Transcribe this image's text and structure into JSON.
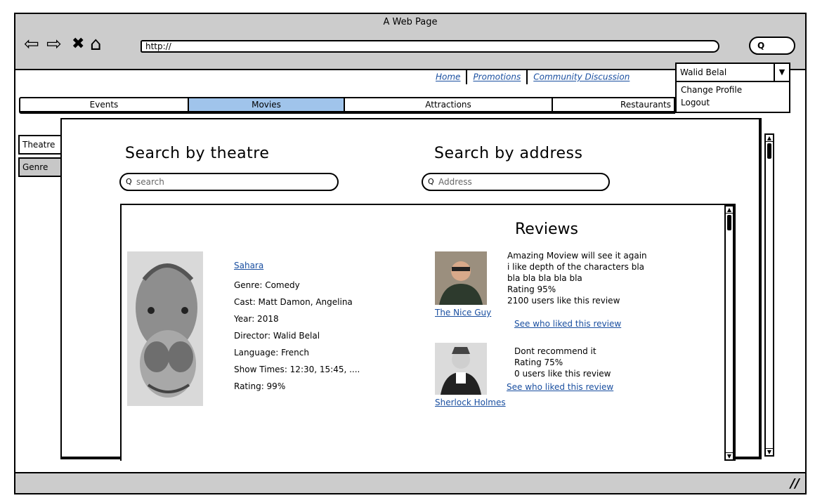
{
  "window": {
    "title": "A Web Page",
    "url": "http://",
    "go_icon": "search-icon"
  },
  "header": {
    "links": [
      "Home",
      "Promotions",
      "Community Discussion"
    ],
    "user": {
      "selected": "Walid Belal",
      "menu": [
        "Change Profile",
        "Logout"
      ]
    }
  },
  "tabs": [
    "Events",
    "Movies",
    "Attractions",
    "Restaurants"
  ],
  "selected_tab": "Movies",
  "side_tabs": [
    "Theatre",
    "Genre"
  ],
  "search_theatre": {
    "heading": "Search by theatre",
    "placeholder": "search"
  },
  "search_address": {
    "heading": "Search by address",
    "placeholder": "Address"
  },
  "movie": {
    "title": "Sahara",
    "genre": "Genre: Comedy",
    "cast": "Cast: Matt Damon, Angelina",
    "year": "Year: 2018",
    "director": "Director: Walid Belal",
    "language": "Language: French",
    "showtimes": "Show Times: 12:30, 15:45, ....",
    "rating": "Rating: 99%"
  },
  "reviews": {
    "heading": "Reviews",
    "items": [
      {
        "user": "The Nice Guy",
        "lines": [
          "Amazing Moview will see it again",
          "i like depth of the characters bla",
          "bla bla bla bla bla",
          "Rating 95%",
          "2100 users like this review"
        ],
        "link": "See who liked this review"
      },
      {
        "user": "Sherlock Holmes",
        "lines": [
          "Dont recommend it",
          "Rating 75%",
          "0 users like this review"
        ],
        "link": "See who liked this review"
      }
    ]
  },
  "colors": {
    "chrome": "#cccccc",
    "selected_tab": "#a0c4eb",
    "link": "#1a4fa0"
  }
}
